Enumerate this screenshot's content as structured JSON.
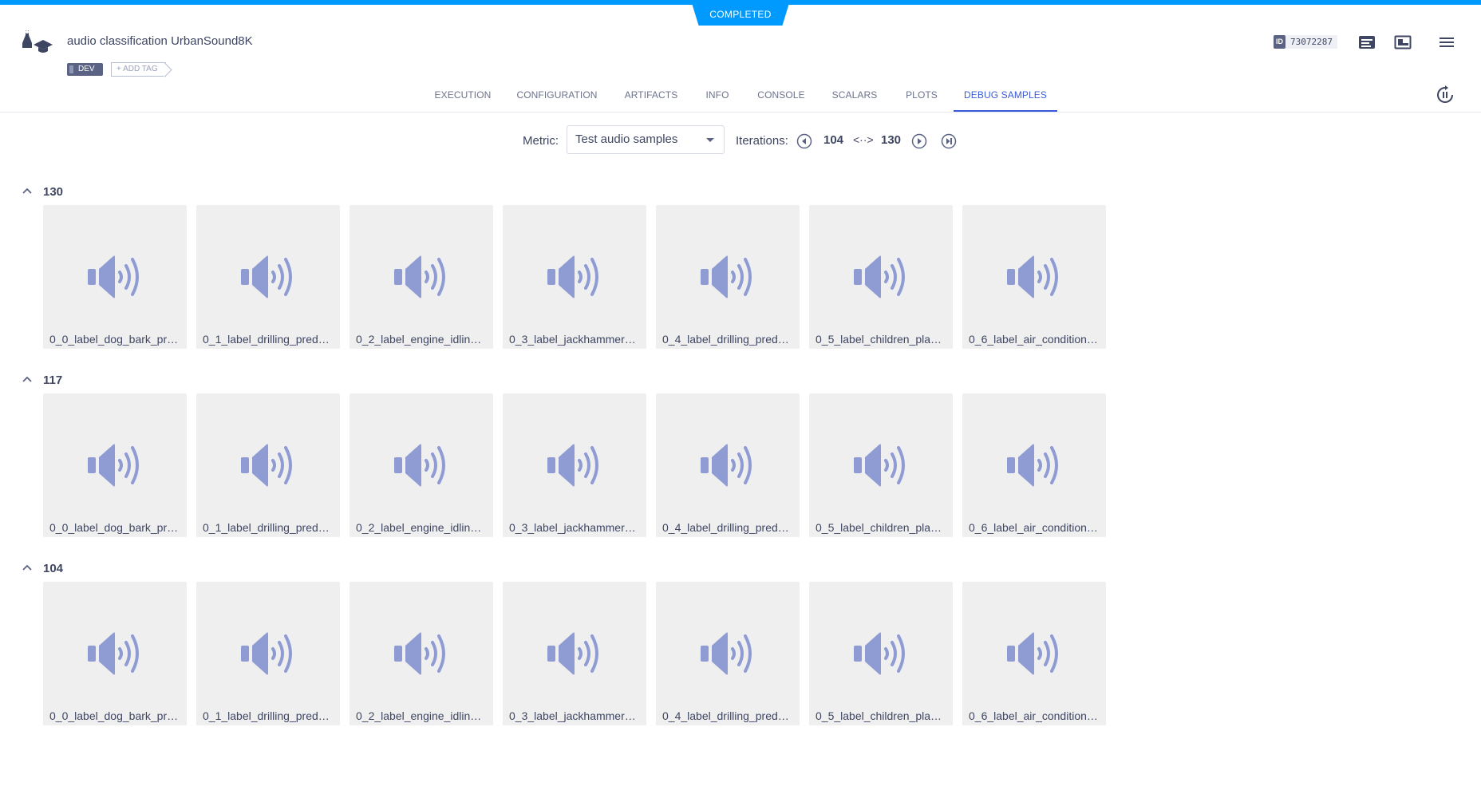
{
  "status": "COMPLETED",
  "header": {
    "title": "audio classification UrbanSound8K",
    "tag": "DEV",
    "add_tag": "+ ADD TAG",
    "id_label": "ID",
    "id_value": "73072287"
  },
  "tabs": [
    {
      "label": "EXECUTION"
    },
    {
      "label": "CONFIGURATION"
    },
    {
      "label": "ARTIFACTS"
    },
    {
      "label": "INFO"
    },
    {
      "label": "CONSOLE"
    },
    {
      "label": "SCALARS"
    },
    {
      "label": "PLOTS"
    },
    {
      "label": "DEBUG SAMPLES",
      "active": true
    }
  ],
  "toolbar": {
    "metric_label": "Metric:",
    "metric_value": "Test audio samples",
    "iterations_label": "Iterations:",
    "iter_from": "104",
    "iter_arrows": "<··>",
    "iter_to": "130"
  },
  "groups": [
    {
      "iteration": "130",
      "samples": [
        "0_0_label_dog_bark_pre...",
        "0_1_label_drilling_pred_...",
        "0_2_label_engine_idling_...",
        "0_3_label_jackhammer_...",
        "0_4_label_drilling_pred_...",
        "0_5_label_children_playi...",
        "0_6_label_air_conditione..."
      ]
    },
    {
      "iteration": "117",
      "samples": [
        "0_0_label_dog_bark_pre...",
        "0_1_label_drilling_pred_...",
        "0_2_label_engine_idling_...",
        "0_3_label_jackhammer_...",
        "0_4_label_drilling_pred_...",
        "0_5_label_children_playi...",
        "0_6_label_air_conditione..."
      ]
    },
    {
      "iteration": "104",
      "samples": [
        "0_0_label_dog_bark_pre...",
        "0_1_label_drilling_pred_...",
        "0_2_label_engine_idling_...",
        "0_3_label_jackhammer_...",
        "0_4_label_drilling_pred_...",
        "0_5_label_children_playi...",
        "0_6_label_air_conditione..."
      ]
    }
  ],
  "icons": {
    "speaker": "speaker-icon",
    "accent": "#3b5bdb",
    "icon_color": "#8f9cd3",
    "status_color": "#009aff"
  }
}
